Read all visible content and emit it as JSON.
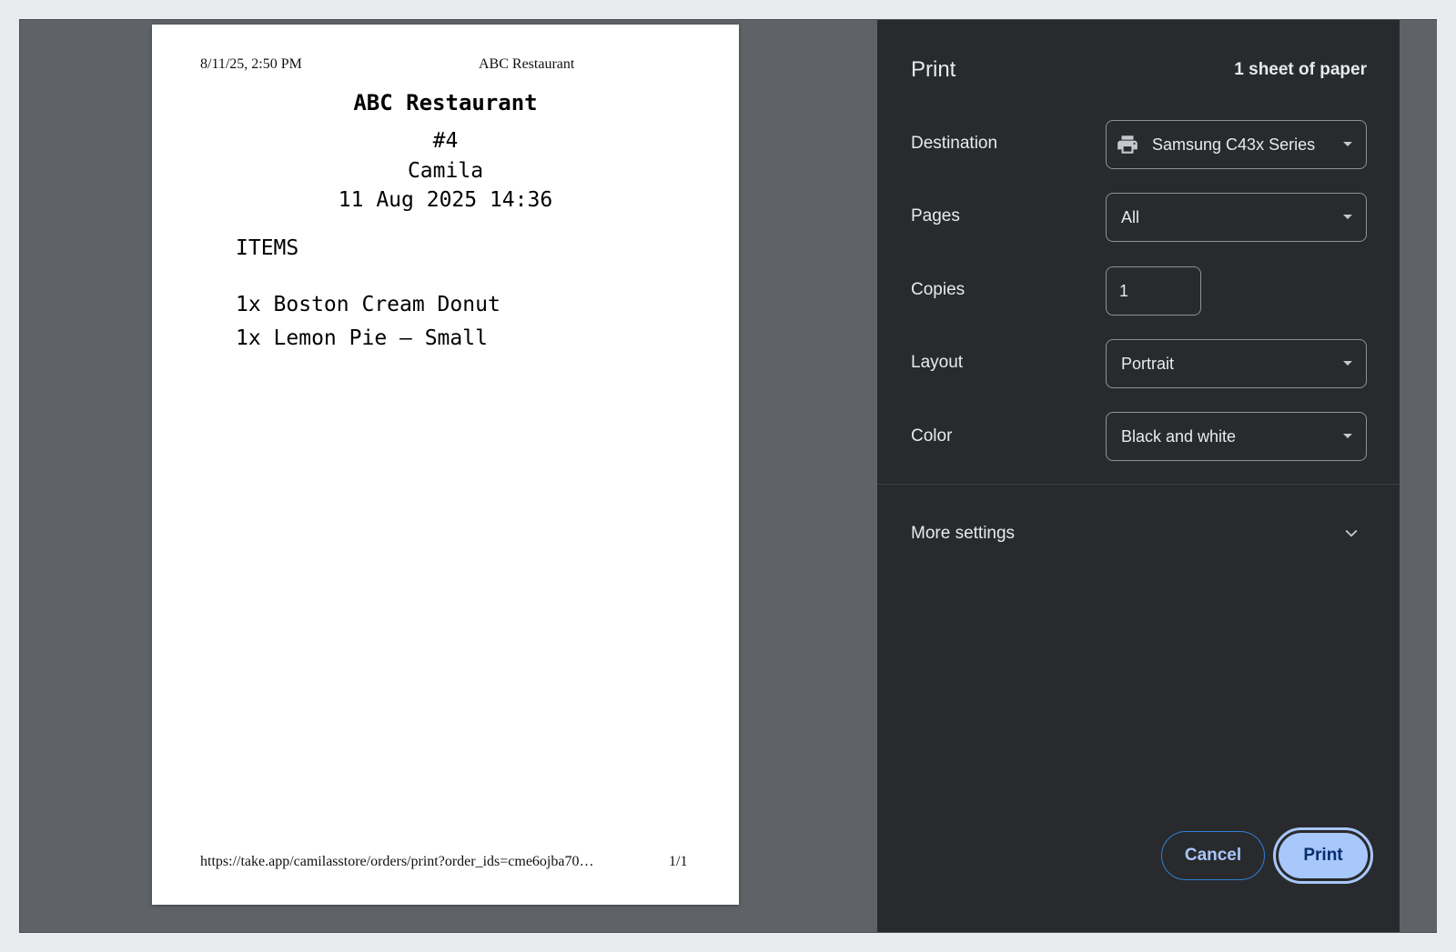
{
  "preview": {
    "header_date": "8/11/25, 2:50 PM",
    "header_title": "ABC Restaurant",
    "receipt": {
      "restaurant_name": "ABC Restaurant",
      "order_number": "#4",
      "customer": "Camila",
      "datetime": "11 Aug 2025 14:36",
      "items_heading": "ITEMS",
      "items": [
        "1x Boston Cream Donut",
        "1x Lemon Pie – Small"
      ]
    },
    "footer_url": "https://take.app/camilasstore/orders/print?order_ids=cme6ojba70…",
    "footer_page": "1/1"
  },
  "panel": {
    "title": "Print",
    "sheet_count": "1 sheet of paper",
    "destination": {
      "label": "Destination",
      "value": "Samsung C43x Series",
      "icon": "printer-icon"
    },
    "pages": {
      "label": "Pages",
      "value": "All"
    },
    "copies": {
      "label": "Copies",
      "value": "1"
    },
    "layout": {
      "label": "Layout",
      "value": "Portrait"
    },
    "color": {
      "label": "Color",
      "value": "Black and white"
    },
    "more_settings": "More settings",
    "cancel_label": "Cancel",
    "print_label": "Print"
  },
  "colors": {
    "panel_bg": "#292a2d",
    "preview_bg": "#5f6368",
    "accent": "#a8c7fa",
    "accent_text": "#062e6f"
  }
}
